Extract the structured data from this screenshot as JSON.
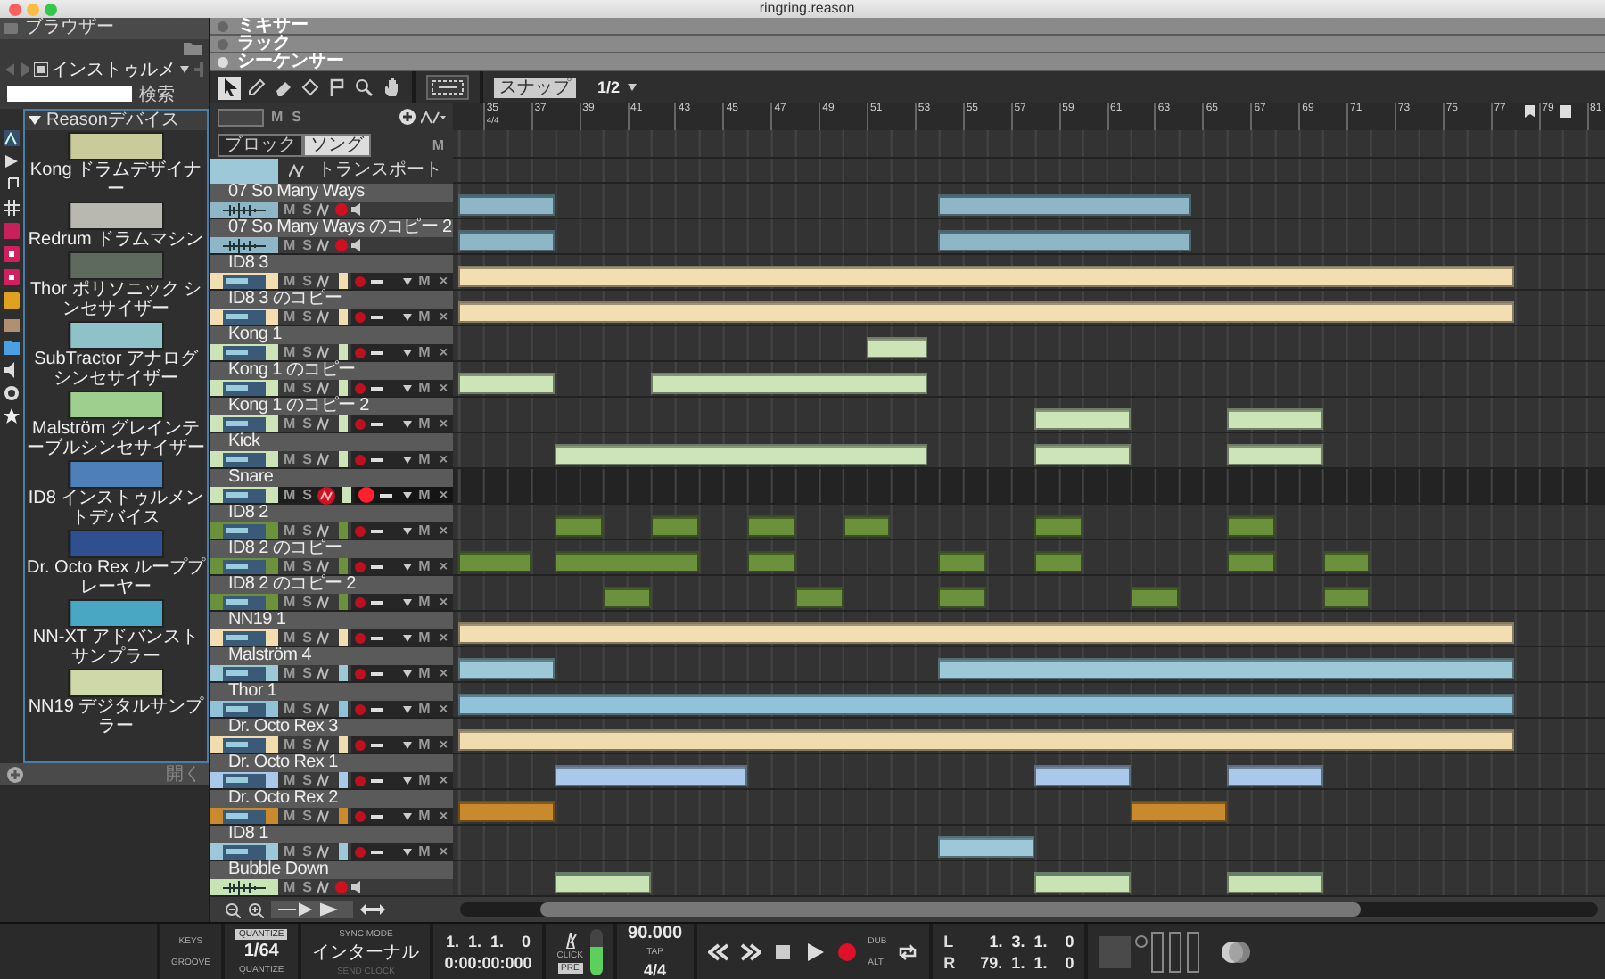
{
  "window": {
    "title": "ringring.reason"
  },
  "browser": {
    "title": "ブラウザー",
    "location": "インストゥルメ",
    "search_button": "検索",
    "folder": {
      "label": "Reasonデバイス",
      "expanded": true
    },
    "devices": [
      {
        "label": "Kong ドラムデザイナー",
        "color": "#c9cc9a"
      },
      {
        "label": "Redrum ドラムマシン",
        "color": "#b8b8b0"
      },
      {
        "label": "Thor ポリソニック シンセサイザー",
        "color": "#5e6a5e"
      },
      {
        "label": "SubTractor アナログシンセサイザー",
        "color": "#8fc1c9"
      },
      {
        "label": "Malström グレインテーブルシンセサイザー",
        "color": "#9fcf8f"
      },
      {
        "label": "ID8 インストゥルメントデバイス",
        "color": "#4f7fb8"
      },
      {
        "label": "Dr. Octo Rex ループプレーヤー",
        "color": "#2f4f8f"
      },
      {
        "label": "NN-XT アドバンストサンプラー",
        "color": "#4aa7c4"
      },
      {
        "label": "NN19 デジタルサンプラー",
        "color": "#cfd8a8"
      }
    ],
    "open_button": "開く"
  },
  "sections": [
    {
      "label": "ミキサー",
      "selected": false
    },
    {
      "label": "ラック",
      "selected": false
    },
    {
      "label": "シーケンサー",
      "selected": true
    }
  ],
  "tools": [
    {
      "kind": "pointer",
      "selected": true
    },
    {
      "kind": "pencil",
      "selected": false
    },
    {
      "kind": "eraser",
      "selected": false
    },
    {
      "kind": "razor",
      "selected": false
    },
    {
      "kind": "flag",
      "selected": false
    },
    {
      "kind": "magnifier",
      "selected": false
    },
    {
      "kind": "hand",
      "selected": false
    }
  ],
  "snap": {
    "label": "スナップ",
    "on": true,
    "value": "1/2"
  },
  "ruler": {
    "mute": "M",
    "solo": "S",
    "bars": [
      "35",
      "37",
      "39",
      "41",
      "43",
      "45",
      "47",
      "49",
      "51",
      "53",
      "55",
      "57",
      "59",
      "61",
      "63",
      "65",
      "67",
      "69",
      "71",
      "73",
      "75",
      "77",
      "79",
      "81"
    ],
    "signature": "4/4"
  },
  "modes": [
    {
      "label": "ブロック",
      "selected": false
    },
    {
      "label": "ソング",
      "selected": true
    }
  ],
  "mode_mute": "M",
  "transport_track": {
    "label": "トランスポート"
  },
  "tracks": [
    {
      "name": "07 So Many Ways",
      "kind": "audio",
      "color": "#8fb6c6",
      "selected": false,
      "mute": "M",
      "solo": "S"
    },
    {
      "name": "07 So Many Ways のコピー 2",
      "kind": "audio",
      "color": "#8fb6c6",
      "selected": false,
      "mute": "M",
      "solo": "S"
    },
    {
      "name": "ID8 3",
      "kind": "instrument",
      "color": "#f3deb1",
      "selected": false,
      "mute": "M",
      "solo": "S",
      "lane_mute": "M",
      "lane_delete": "×"
    },
    {
      "name": "ID8 3 のコピー",
      "kind": "instrument",
      "color": "#f3deb1",
      "selected": false,
      "mute": "M",
      "solo": "S",
      "lane_mute": "M",
      "lane_delete": "×"
    },
    {
      "name": "Kong 1",
      "kind": "instrument",
      "color": "#cde4b8",
      "selected": false,
      "mute": "M",
      "solo": "S",
      "lane_mute": "M",
      "lane_delete": "×"
    },
    {
      "name": "Kong 1 のコピー",
      "kind": "instrument",
      "color": "#cde4b8",
      "selected": false,
      "mute": "M",
      "solo": "S",
      "lane_mute": "M",
      "lane_delete": "×"
    },
    {
      "name": "Kong 1 のコピー 2",
      "kind": "instrument",
      "color": "#cde4b8",
      "selected": false,
      "mute": "M",
      "solo": "S",
      "lane_mute": "M",
      "lane_delete": "×"
    },
    {
      "name": "Kick",
      "kind": "instrument",
      "color": "#cde4b8",
      "selected": false,
      "mute": "M",
      "solo": "S",
      "lane_mute": "M",
      "lane_delete": "×"
    },
    {
      "name": "Snare",
      "kind": "instrument",
      "color": "#cde4b8",
      "selected": true,
      "mute": "M",
      "solo": "S",
      "lane_mute": "M",
      "lane_delete": "×"
    },
    {
      "name": "ID8 2",
      "kind": "instrument",
      "color": "#6b913c",
      "selected": false,
      "mute": "M",
      "solo": "S",
      "lane_mute": "M",
      "lane_delete": "×"
    },
    {
      "name": "ID8 2 のコピー",
      "kind": "instrument",
      "color": "#6b913c",
      "selected": false,
      "mute": "M",
      "solo": "S",
      "lane_mute": "M",
      "lane_delete": "×"
    },
    {
      "name": "ID8 2 のコピー 2",
      "kind": "instrument",
      "color": "#6b913c",
      "selected": false,
      "mute": "M",
      "solo": "S",
      "lane_mute": "M",
      "lane_delete": "×"
    },
    {
      "name": "NN19 1",
      "kind": "instrument",
      "color": "#f3deb1",
      "selected": false,
      "mute": "M",
      "solo": "S",
      "lane_mute": "M",
      "lane_delete": "×"
    },
    {
      "name": "Malström 4",
      "kind": "instrument",
      "color": "#9cc8d8",
      "selected": false,
      "mute": "M",
      "solo": "S",
      "lane_mute": "M",
      "lane_delete": "×"
    },
    {
      "name": "Thor 1",
      "kind": "instrument",
      "color": "#92c2d8",
      "selected": false,
      "mute": "M",
      "solo": "S",
      "lane_mute": "M",
      "lane_delete": "×"
    },
    {
      "name": "Dr. Octo Rex 3",
      "kind": "instrument",
      "color": "#f1dcae",
      "selected": false,
      "mute": "M",
      "solo": "S",
      "lane_mute": "M",
      "lane_delete": "×"
    },
    {
      "name": "Dr. Octo Rex 1",
      "kind": "instrument",
      "color": "#aac9ea",
      "selected": false,
      "mute": "M",
      "solo": "S",
      "lane_mute": "M",
      "lane_delete": "×"
    },
    {
      "name": "Dr. Octo Rex 2",
      "kind": "instrument",
      "color": "#c98a2e",
      "selected": false,
      "mute": "M",
      "solo": "S",
      "lane_mute": "M",
      "lane_delete": "×"
    },
    {
      "name": "ID8 1",
      "kind": "instrument",
      "color": "#9cc8da",
      "selected": false,
      "mute": "M",
      "solo": "S",
      "lane_mute": "M",
      "lane_delete": "×"
    },
    {
      "name": "Bubble Down",
      "kind": "audio",
      "color": "#c8e3b4",
      "selected": false,
      "mute": "M",
      "solo": "S"
    }
  ],
  "transport": {
    "keys": "KEYS",
    "groove": "GROOVE",
    "quantize": {
      "label": "QUANTIZE",
      "on": true,
      "value": "1/64",
      "caption": "QUANTIZE"
    },
    "sync": {
      "label": "SYNC MODE",
      "value": "インターナル",
      "caption": "SEND CLOCK"
    },
    "position": {
      "bars": "1.  1.  1.    0",
      "time": "0:00:00:000"
    },
    "click": {
      "label": "CLICK",
      "pre": "PRE",
      "level": 0.6
    },
    "tempo": {
      "value": "90.000",
      "tap": "TAP",
      "signature": "4/4"
    },
    "controls": [
      {
        "kind": "rewind"
      },
      {
        "kind": "forward"
      },
      {
        "kind": "stop"
      },
      {
        "kind": "play"
      },
      {
        "kind": "record"
      }
    ],
    "dub": "DUB",
    "alt": "ALT",
    "locators": {
      "left_label": "L",
      "left": "1.  3.  1.    0",
      "right_label": "R",
      "right": "79.  1.  1.    0"
    }
  }
}
